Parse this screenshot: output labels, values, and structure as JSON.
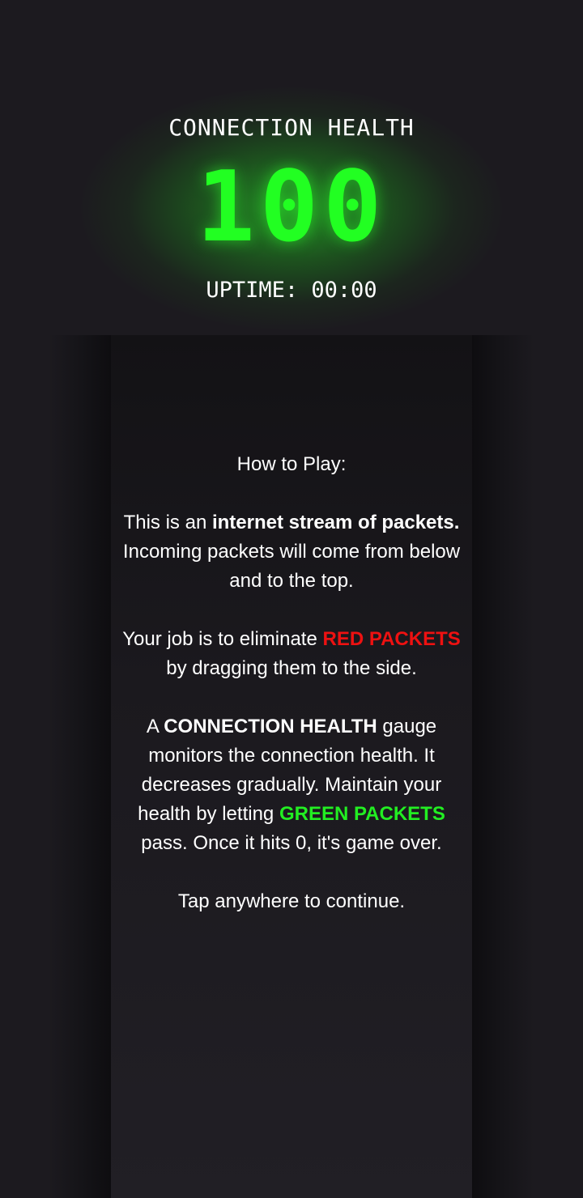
{
  "hud": {
    "title": "CONNECTION HEALTH",
    "health": "100",
    "uptime_label": "UPTIME:",
    "uptime_value": "00:00"
  },
  "instructions": {
    "heading": "How to Play:",
    "p1_a": "This is an ",
    "p1_b": "internet stream of packets.",
    "p1_c": " Incoming packets will come from below and to the top.",
    "p2_a": "Your job is to eliminate ",
    "p2_b": "RED PACKETS",
    "p2_c": " by dragging them to the side.",
    "p3_a": "A ",
    "p3_b": "CONNECTION HEALTH",
    "p3_c": " gauge monitors the connection health. It decreases gradually. Maintain your health by letting ",
    "p3_d": "GREEN PACKETS",
    "p3_e": " pass. Once it hits 0, it's game over.",
    "continue": "Tap anywhere to continue."
  },
  "colors": {
    "health_green": "#22ff22",
    "red_packet": "#ee1111",
    "green_packet": "#22ee22",
    "background": "#1c1a1f"
  }
}
